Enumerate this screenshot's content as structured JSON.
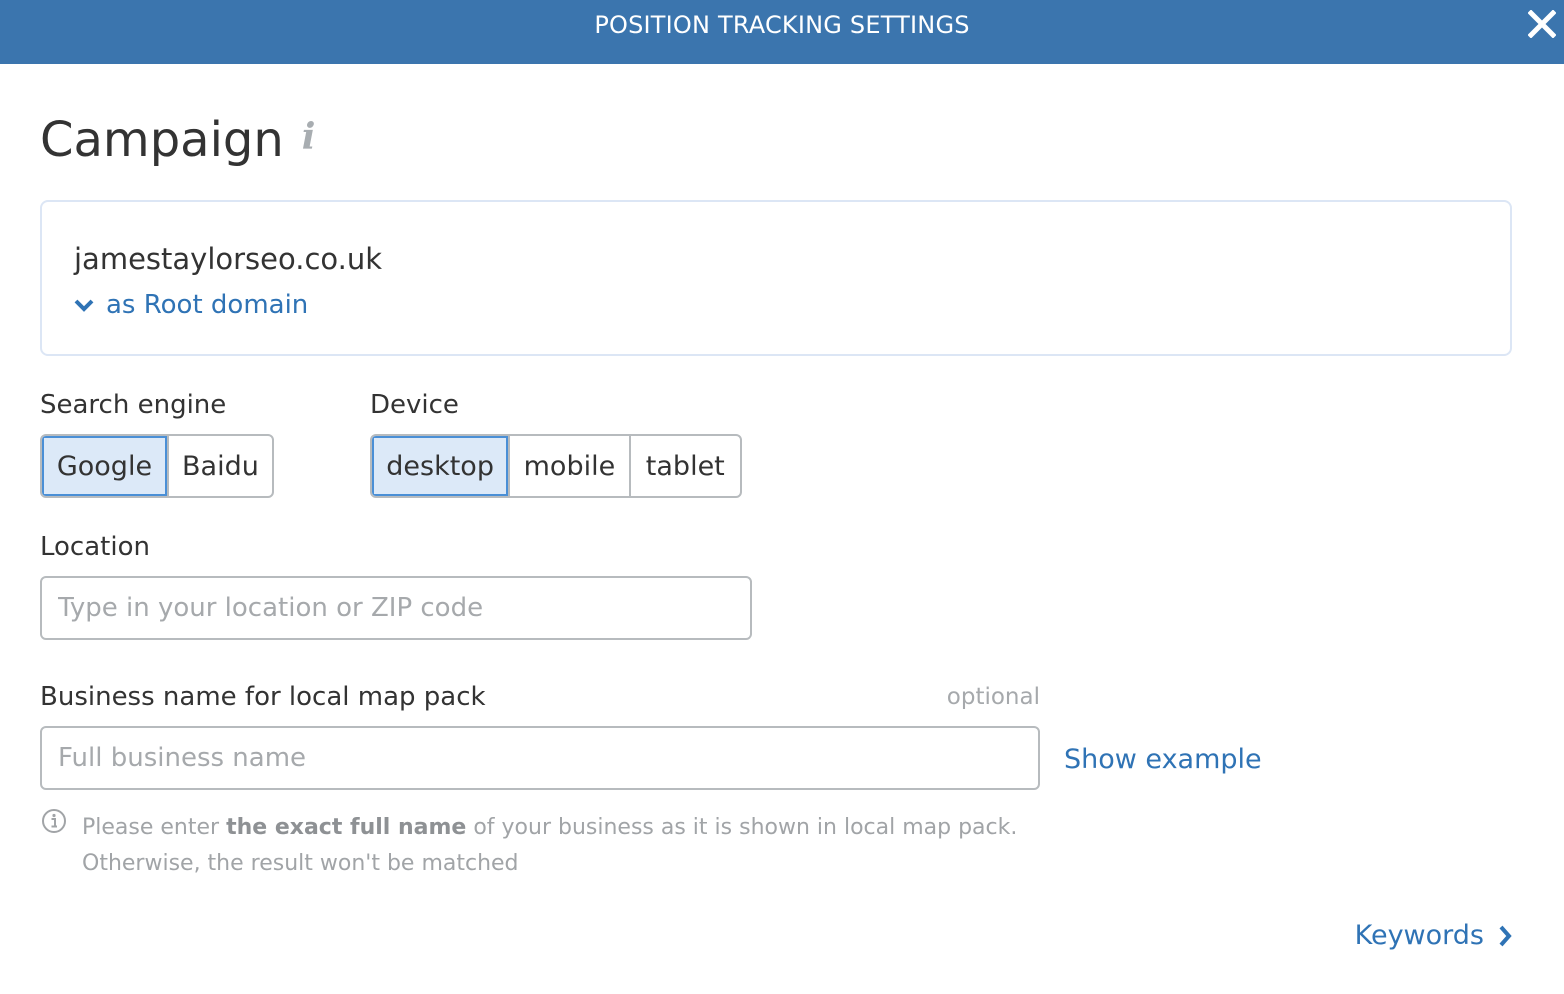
{
  "header": {
    "title": "POSITION TRACKING SETTINGS",
    "close_icon": "close-icon",
    "background_color": "#3b75ae"
  },
  "page": {
    "title": "Campaign",
    "title_info_icon": "info-icon"
  },
  "domain": {
    "name": "jamestaylorseo.co.uk",
    "type_label": "as Root domain",
    "type_icon": "chevron-down-icon"
  },
  "search_engine": {
    "label": "Search engine",
    "options": [
      "Google",
      "Baidu"
    ],
    "selected": "Google"
  },
  "device": {
    "label": "Device",
    "options": [
      "desktop",
      "mobile",
      "tablet"
    ],
    "selected": "desktop"
  },
  "location": {
    "label": "Location",
    "value": "",
    "placeholder": "Type in your location or ZIP code"
  },
  "business": {
    "label": "Business name for local map pack",
    "optional_label": "optional",
    "value": "",
    "placeholder": "Full business name",
    "show_example_label": "Show example",
    "hint_icon": "info-circle-icon",
    "hint_prefix": "Please enter ",
    "hint_bold": "the exact full name",
    "hint_suffix": " of your business as it is shown in local map pack.",
    "hint_line2": "Otherwise, the result won't be matched"
  },
  "footer": {
    "next_label": "Keywords",
    "next_icon": "chevron-right-icon"
  },
  "colors": {
    "accent": "#2f73b5",
    "selected_bg": "#dce9f8",
    "selected_border": "#4a8fd6"
  }
}
